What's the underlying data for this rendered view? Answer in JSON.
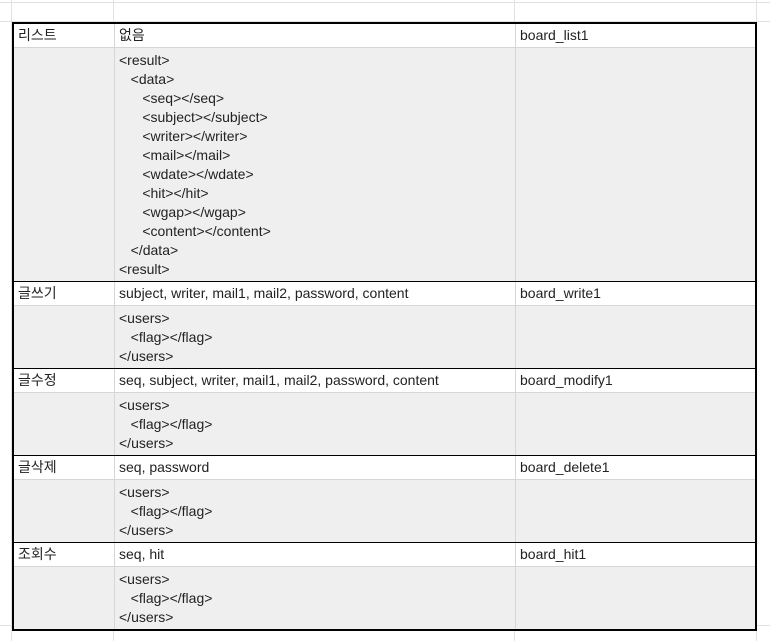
{
  "rows": [
    {
      "name": "리스트",
      "params": "없음",
      "id": "board_list1",
      "response": "<result>\n   <data>\n      <seq></seq>\n      <subject></subject>\n      <writer></writer>\n      <mail></mail>\n      <wdate></wdate>\n      <hit></hit>\n      <wgap></wgap>\n      <content></content>\n   </data>\n<result>"
    },
    {
      "name": "글쓰기",
      "params": "subject, writer, mail1, mail2, password, content",
      "id": "board_write1",
      "response": "<users>\n   <flag></flag>\n</users>"
    },
    {
      "name": "글수정",
      "params": "seq, subject, writer, mail1, mail2, password, content",
      "id": "board_modify1",
      "response": "<users>\n   <flag></flag>\n</users>"
    },
    {
      "name": "글삭제",
      "params": "seq, password",
      "id": "board_delete1",
      "response": "<users>\n   <flag></flag>\n</users>"
    },
    {
      "name": "조회수",
      "params": "seq, hit",
      "id": "board_hit1",
      "response": "<users>\n   <flag></flag>\n</users>"
    }
  ]
}
